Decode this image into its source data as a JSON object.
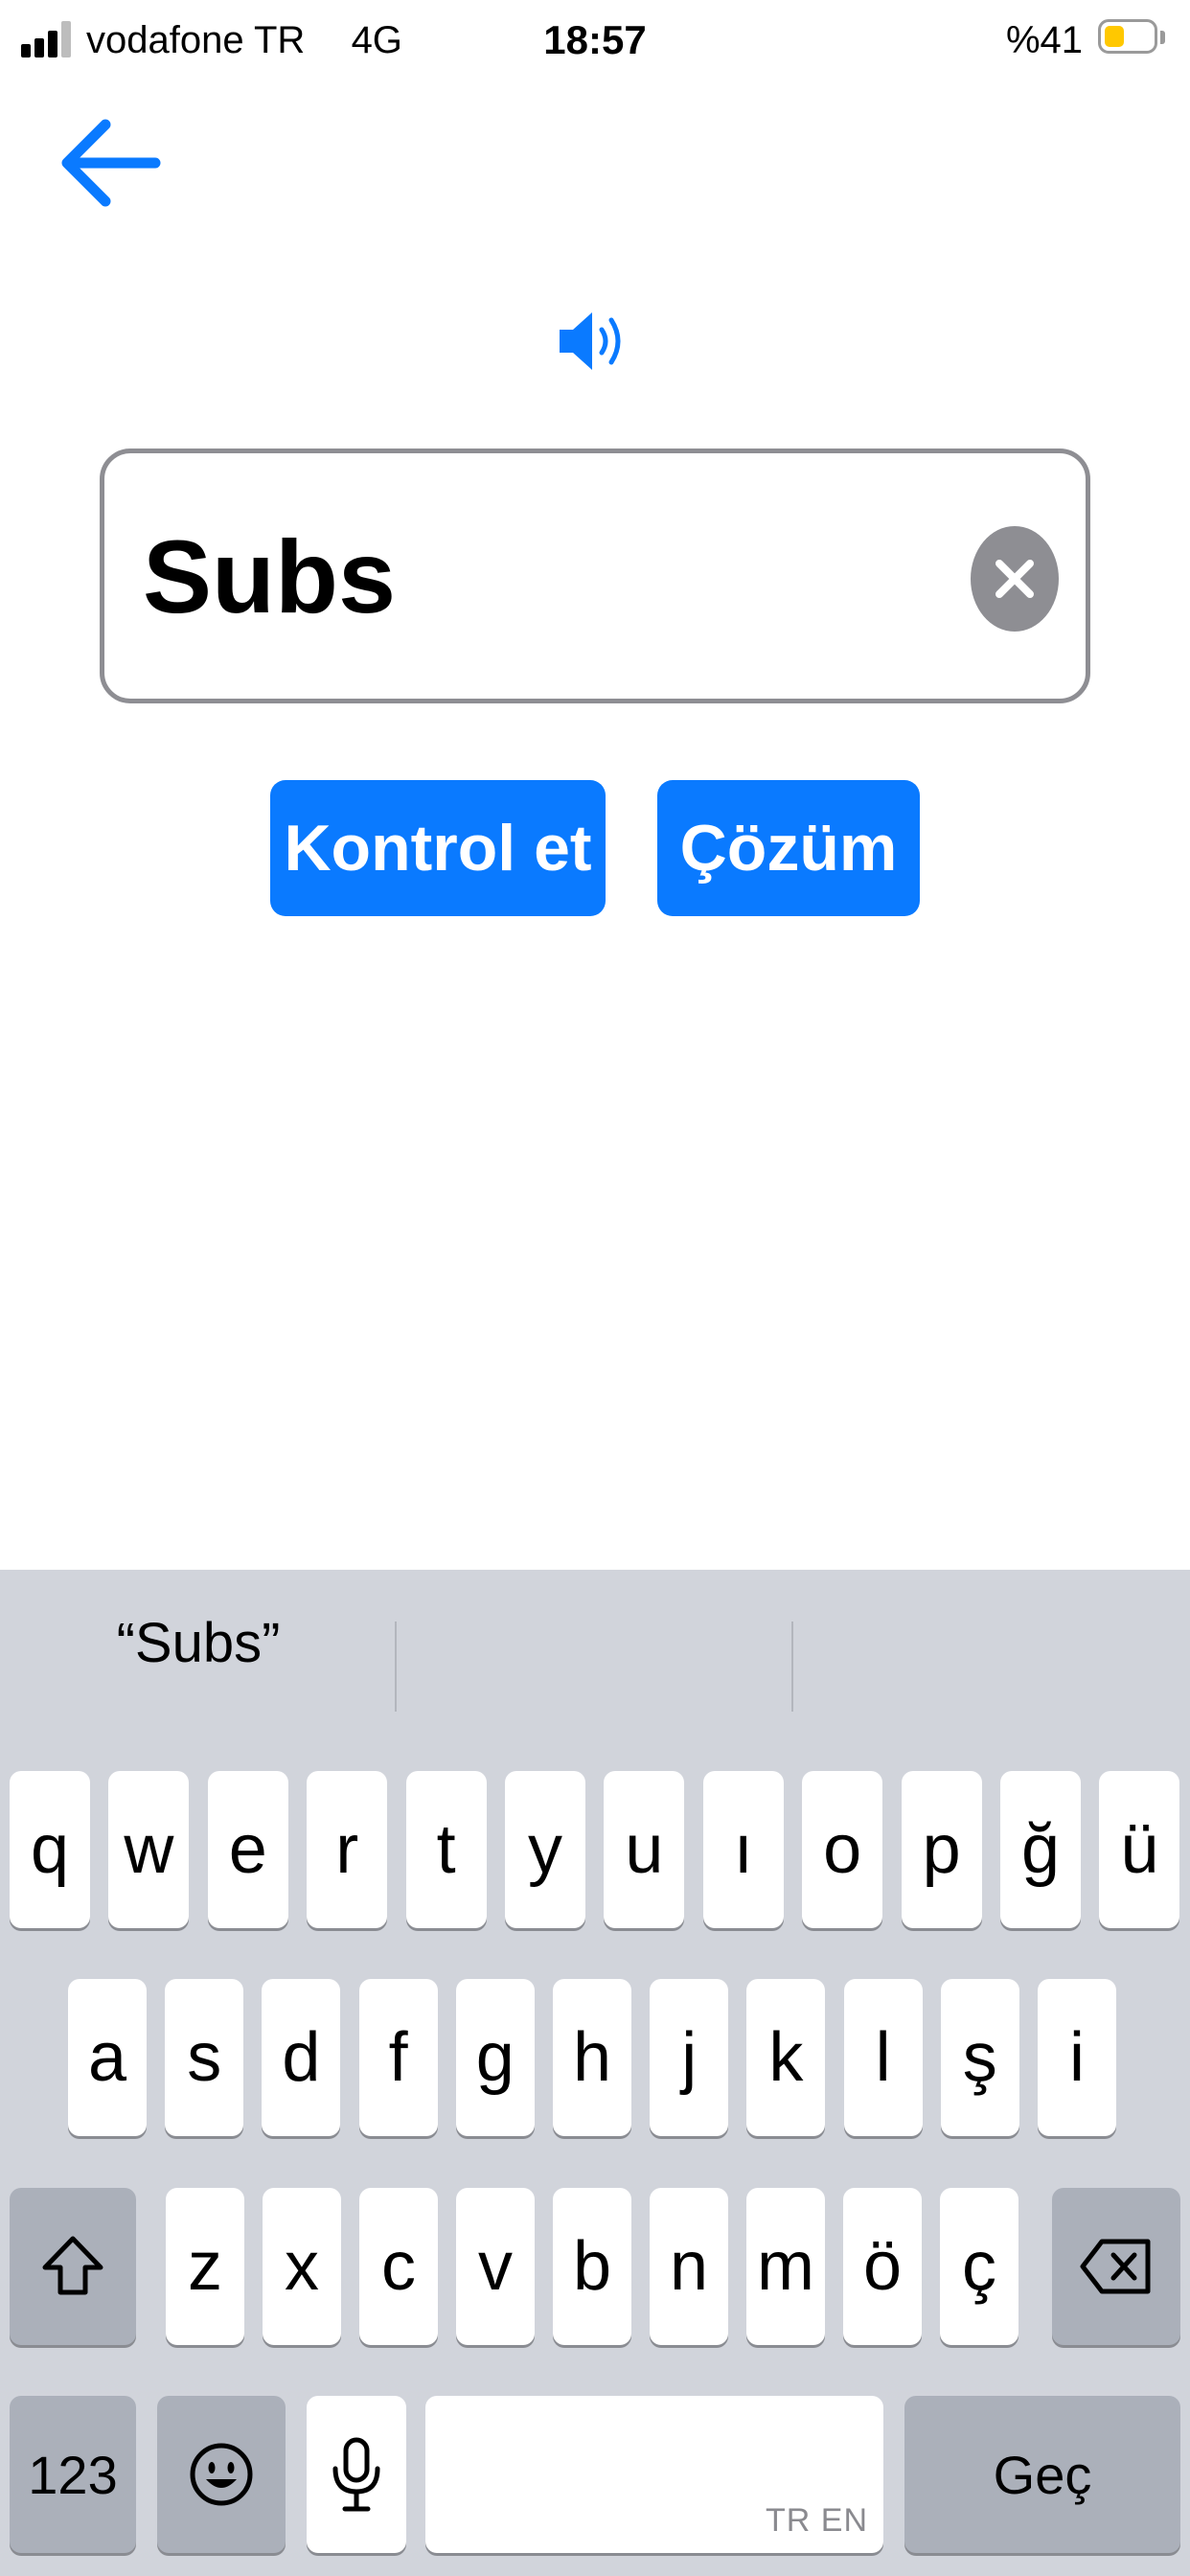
{
  "status_bar": {
    "carrier": "vodafone TR",
    "network": "4G",
    "time": "18:57",
    "battery_percent": "%41",
    "battery_level": 0.41,
    "battery_color": "#ffc800",
    "signal_bars_filled": 3,
    "signal_bars_total": 4
  },
  "nav": {
    "back_icon": "arrow-left-icon"
  },
  "audio": {
    "icon": "speaker-icon"
  },
  "answer": {
    "value": "Subs",
    "clear_icon": "clear-x-icon"
  },
  "actions": {
    "check_label": "Kontrol et",
    "solution_label": "Çözüm"
  },
  "colors": {
    "accent": "#0a7aff",
    "keyboard_bg": "#d1d4db",
    "dark_key": "#abb0ba"
  },
  "keyboard": {
    "suggestions": [
      "“Subs”",
      "",
      ""
    ],
    "row1": [
      "q",
      "w",
      "e",
      "r",
      "t",
      "y",
      "u",
      "ı",
      "o",
      "p",
      "ğ",
      "ü"
    ],
    "row2": [
      "a",
      "s",
      "d",
      "f",
      "g",
      "h",
      "j",
      "k",
      "l",
      "ş",
      "i"
    ],
    "row3": [
      "z",
      "x",
      "c",
      "v",
      "b",
      "n",
      "m",
      "ö",
      "ç"
    ],
    "numbers_label": "123",
    "return_label": "Geç",
    "space_hint": "TR EN",
    "shift_icon": "shift-icon",
    "delete_icon": "backspace-icon",
    "emoji_icon": "emoji-icon",
    "mic_icon": "microphone-icon"
  }
}
